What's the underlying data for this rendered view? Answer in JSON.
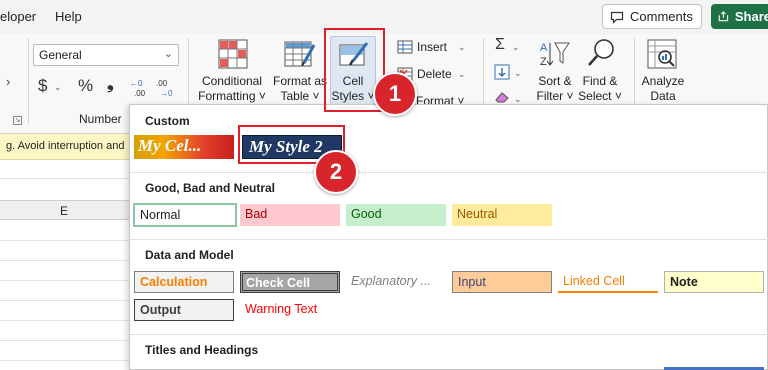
{
  "menubar": {
    "items": [
      "eloper",
      "Help"
    ],
    "comments_label": "Comments",
    "share_label": "Share"
  },
  "ribbon": {
    "number_format_value": "General",
    "number_group_label": "Number",
    "conditional_formatting_label": [
      "Conditional",
      "Formatting ˅"
    ],
    "format_as_table_label": [
      "Format as",
      "Table ˅"
    ],
    "cell_styles_label": [
      "Cell",
      "Styles ˅"
    ],
    "insert_label": "Insert",
    "delete_label": "Delete",
    "format_label": "Format ˅",
    "sort_filter_label": [
      "Sort &",
      "Filter ˅"
    ],
    "find_select_label": [
      "Find &",
      "Select ˅"
    ],
    "analyze_data_label": [
      "Analyze",
      "Data"
    ],
    "currency_symbol": "$",
    "percent_symbol": "%",
    "comma_symbol": "❟",
    "sum_symbol": "Σ"
  },
  "sheet": {
    "notice_text": "g. Avoid interruption and",
    "column_label": "E"
  },
  "callouts": [
    "1",
    "2"
  ],
  "cell_styles_gallery": {
    "custom": {
      "title": "Custom",
      "styles": [
        "My Cel...",
        "My Style 2"
      ]
    },
    "good_bad_neutral": {
      "title": "Good, Bad and Neutral",
      "styles": [
        "Normal",
        "Bad",
        "Good",
        "Neutral"
      ]
    },
    "data_and_model": {
      "title": "Data and Model",
      "styles_row1": [
        "Calculation",
        "Check Cell",
        "Explanatory ...",
        "Input",
        "Linked Cell",
        "Note"
      ],
      "styles_row2": [
        "Output",
        "Warning Text"
      ]
    },
    "titles_and_headings": {
      "title": "Titles and Headings"
    }
  },
  "colors": {
    "excel_green": "#1e7145",
    "callout_red": "#d8242b",
    "bad_fill": "#ffc7ce",
    "bad_text": "#9c0006",
    "good_fill": "#c6efce",
    "good_text": "#006100",
    "neutral_fill": "#ffeb9c",
    "neutral_text": "#9c5700",
    "input_fill": "#ffcc99",
    "note_fill": "#ffffcc",
    "calculation_text": "#fa7d00",
    "warning_text": "#ff0000",
    "check_cell_fill": "#a5a5a5",
    "my_style2_fill": "#1f3864"
  }
}
